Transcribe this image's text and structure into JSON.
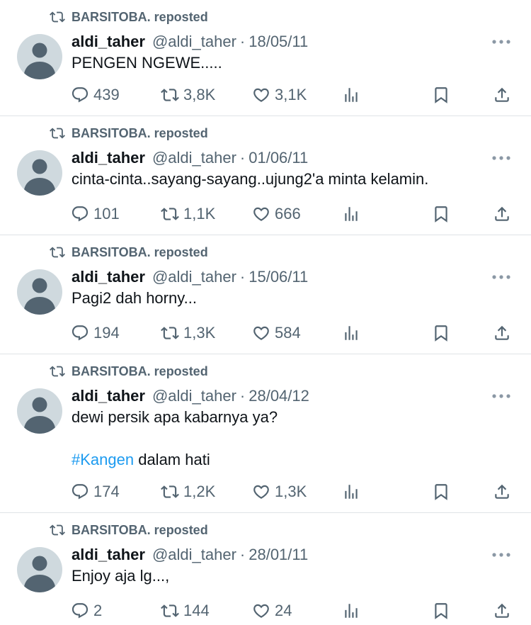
{
  "tweets": [
    {
      "reposter": "BARSITOBA. reposted",
      "name": "aldi_taher",
      "handle": "@aldi_taher",
      "sep": "·",
      "date": "18/05/11",
      "text1": "PENGEN NGEWE.....",
      "replies": "439",
      "retweets": "3,8K",
      "likes": "3,1K"
    },
    {
      "reposter": "BARSITOBA. reposted",
      "name": "aldi_taher",
      "handle": "@aldi_taher",
      "sep": "·",
      "date": "01/06/11",
      "text1": "cinta-cinta..sayang-sayang..ujung2'a minta kelamin.",
      "replies": "101",
      "retweets": "1,1K",
      "likes": "666"
    },
    {
      "reposter": "BARSITOBA. reposted",
      "name": "aldi_taher",
      "handle": "@aldi_taher",
      "sep": "·",
      "date": "15/06/11",
      "text1": "Pagi2 dah horny...",
      "replies": "194",
      "retweets": "1,3K",
      "likes": "584"
    },
    {
      "reposter": "BARSITOBA. reposted",
      "name": "aldi_taher",
      "handle": "@aldi_taher",
      "sep": "·",
      "date": "28/04/12",
      "text1": "dewi persik apa kabarnya ya?",
      "hashtag": "#Kangen",
      "text2_rest": " dalam hati",
      "replies": "174",
      "retweets": "1,2K",
      "likes": "1,3K"
    },
    {
      "reposter": "BARSITOBA. reposted",
      "name": "aldi_taher",
      "handle": "@aldi_taher",
      "sep": "·",
      "date": "28/01/11",
      "text1": "Enjoy aja lg...,",
      "replies": "2",
      "retweets": "144",
      "likes": "24"
    }
  ],
  "colors": {
    "primary_text": "#0f1419",
    "secondary_text": "#536471",
    "hashtag": "#1d9bf0",
    "divider": "#dfe3e6",
    "avatar_bg": "#cfd9de"
  },
  "icons": [
    "repost-icon",
    "more-icon",
    "reply-icon",
    "retweet-icon",
    "like-icon",
    "views-icon",
    "bookmark-icon",
    "share-icon"
  ]
}
